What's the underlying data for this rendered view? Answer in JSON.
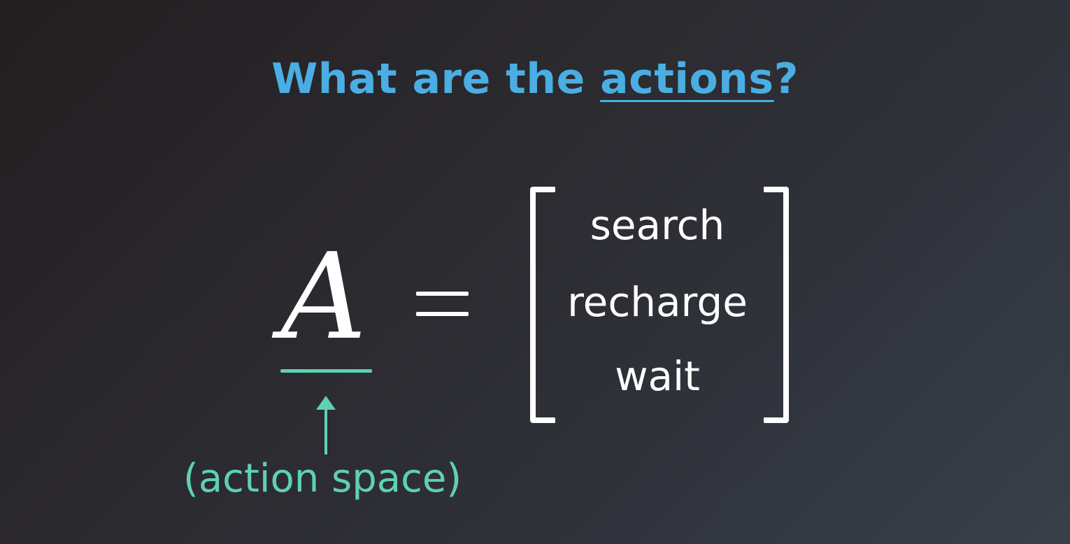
{
  "title": {
    "prefix": "What are the ",
    "keyword": "actions",
    "suffix": "?"
  },
  "equation": {
    "symbol": "A",
    "equals": "=",
    "items": [
      "search",
      "recharge",
      "wait"
    ]
  },
  "annotation": {
    "label": "(action space)"
  },
  "colors": {
    "title": "#4aaee3",
    "accent": "#5fd0b5",
    "text": "#ffffff"
  }
}
